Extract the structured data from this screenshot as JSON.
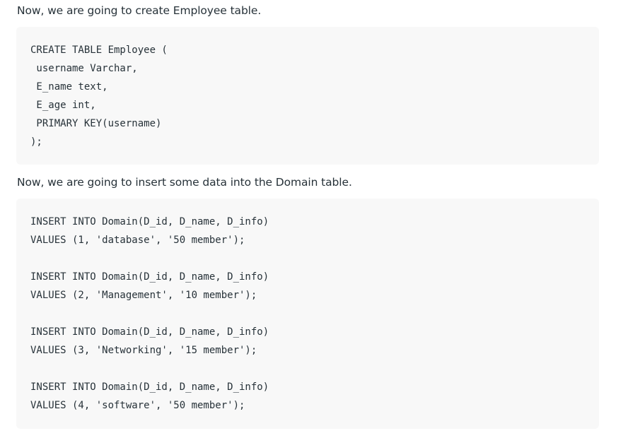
{
  "intro_create": "Now, we are going to create Employee table.",
  "create_code": [
    "CREATE TABLE Employee (",
    " username Varchar,",
    " E_name text,",
    " E_age int,",
    " PRIMARY KEY(username)",
    ");"
  ],
  "intro_insert": "Now, we are going to insert some data into the Domain table.",
  "insert_code": [
    "INSERT INTO Domain(D_id, D_name, D_info)",
    "VALUES (1, 'database', '50 member');",
    "",
    "INSERT INTO Domain(D_id, D_name, D_info)",
    "VALUES (2, 'Management', '10 member');",
    "",
    "INSERT INTO Domain(D_id, D_name, D_info)",
    "VALUES (3, 'Networking', '15 member');",
    "",
    "INSERT INTO Domain(D_id, D_name, D_info)",
    "VALUES (4, 'software', '50 member');"
  ]
}
